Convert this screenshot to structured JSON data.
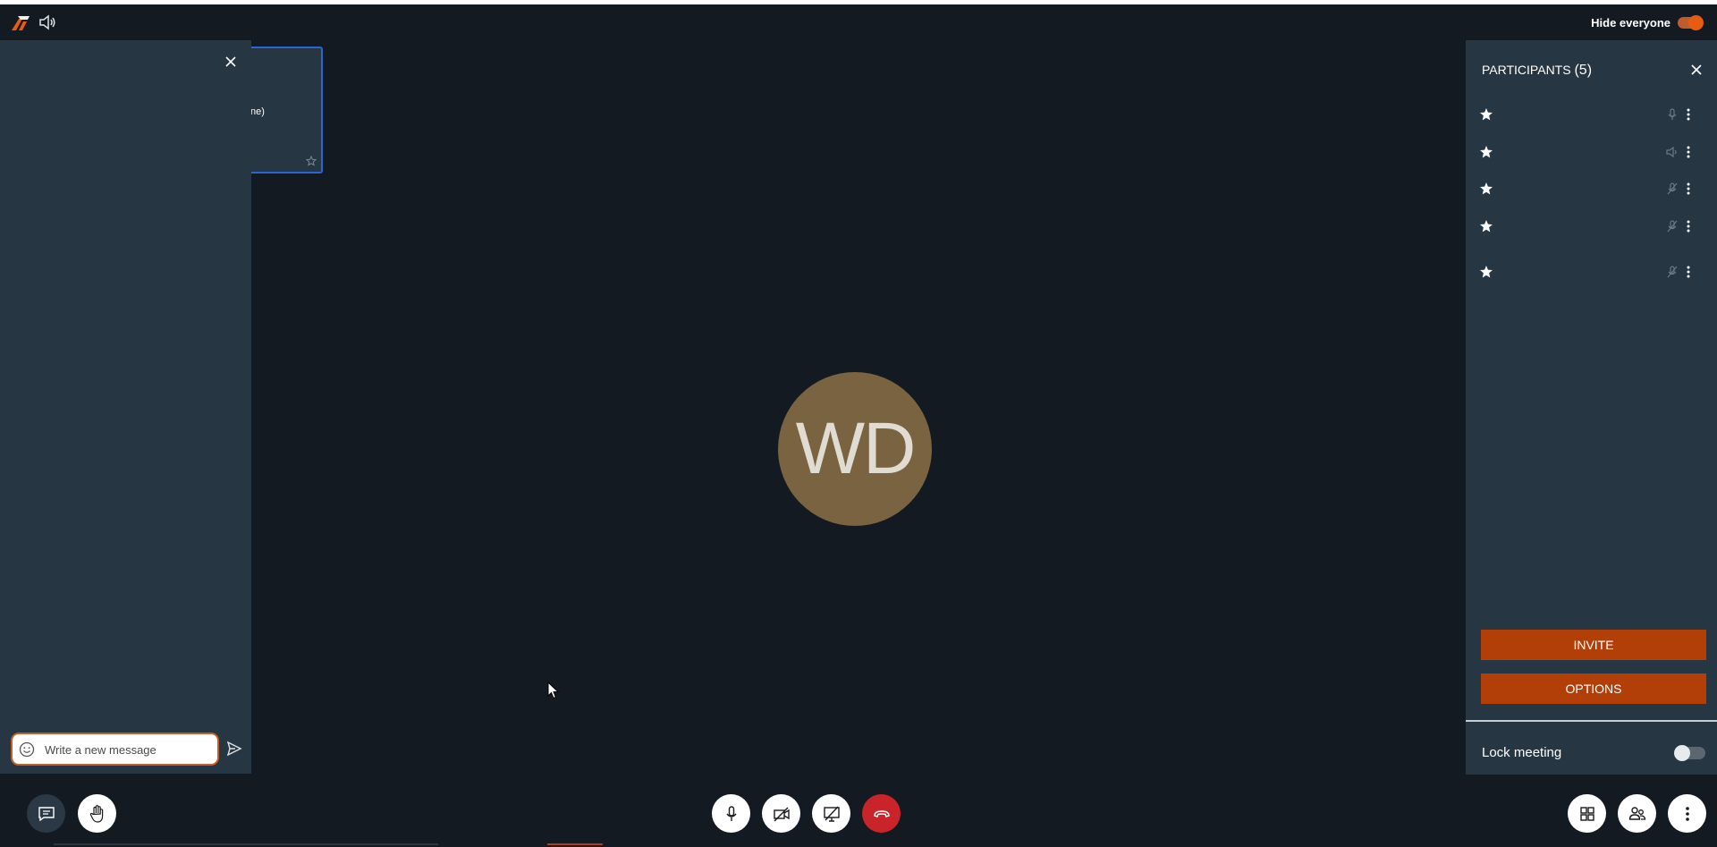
{
  "topbar": {
    "hide_everyone_label": "Hide everyone",
    "hide_everyone_on": true
  },
  "chat": {
    "message_placeholder": "Write a new message"
  },
  "filmstrip": {
    "tile_name_fragment": "ne)"
  },
  "stage": {
    "avatar_initials": "WD",
    "avatar_color": "#7a6341"
  },
  "participants": {
    "title": "PARTICIPANTS",
    "count": "(5)",
    "rows": [
      {
        "mic": "mic-icon"
      },
      {
        "mic": "speaker-icon"
      },
      {
        "mic": "mic-muted-icon"
      },
      {
        "mic": "mic-muted-icon"
      },
      {
        "mic": "mic-muted-icon"
      }
    ],
    "invite_label": "INVITE",
    "options_label": "OPTIONS",
    "lock_meeting_label": "Lock meeting",
    "lock_meeting_on": false
  },
  "colors": {
    "accent": "#b33f08",
    "panel": "#263642",
    "background": "#141a21",
    "hangup": "#c8242a",
    "focus_border": "#2866d2"
  }
}
